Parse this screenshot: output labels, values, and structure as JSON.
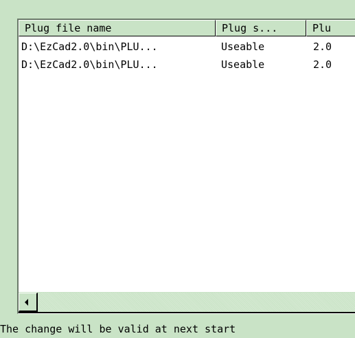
{
  "list": {
    "columns": [
      "Plug file name",
      "Plug s...",
      "Plu"
    ],
    "rows": [
      [
        "D:\\EzCad2.0\\bin\\PLU...",
        "Useable",
        "2.0"
      ],
      [
        "D:\\EzCad2.0\\bin\\PLU...",
        "Useable",
        "2.0"
      ]
    ]
  },
  "status": "The change will be valid at next start",
  "colors": {
    "background": "#c9e3c6",
    "list_background": "#ffffff"
  }
}
